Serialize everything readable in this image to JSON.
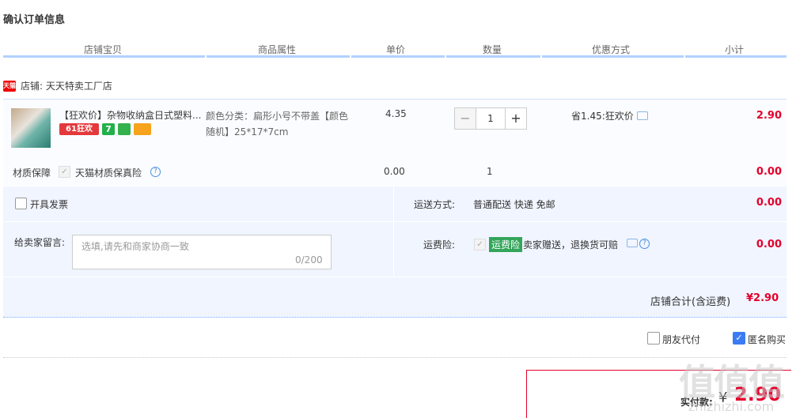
{
  "page_title": "确认订单信息",
  "columns": [
    "店铺宝贝",
    "商品属性",
    "单价",
    "数量",
    "优惠方式",
    "小计"
  ],
  "shop": {
    "badge": "天猫",
    "name": "店铺: 天天特卖工厂店"
  },
  "item": {
    "title": "【狂欢价】杂物收纳盒日式塑料...",
    "tag_61": "61狂欢",
    "tag_7": "7",
    "attr_line1": "颜色分类：扁形小号不带盖【颜色",
    "attr_line2": "随机】25*17*7cm",
    "price": "4.35",
    "qty_minus": "−",
    "qty_value": "1",
    "qty_plus": "+",
    "discount": "省1.45:狂欢价",
    "subtotal": "2.90"
  },
  "material": {
    "label": "材质保障",
    "check": "✓",
    "text": "天猫材质保真险",
    "help": "?",
    "price": "0.00",
    "qty": "1",
    "subtotal": "0.00"
  },
  "invoice": {
    "label": "开具发票"
  },
  "shipping": {
    "label": "运送方式:",
    "value": "普通配送 快递 免邮",
    "subtotal": "0.00"
  },
  "message": {
    "label": "给卖家留言:",
    "placeholder": "选填,请先和商家协商一致",
    "count": "0/200"
  },
  "insurance": {
    "label": "运费险:",
    "check": "✓",
    "badge": "运费险",
    "text": "卖家赠送，退换货可赔",
    "help": "?",
    "subtotal": "0.00"
  },
  "shop_total": {
    "label": "店铺合计(含运费)",
    "value": "¥2.90"
  },
  "options": {
    "friend_pay": "朋友代付",
    "anonymous": "匿名购买",
    "anon_check": "✓"
  },
  "payment": {
    "label": "实付款:",
    "currency": "¥",
    "value": "2.90"
  },
  "watermark": {
    "text": "值值值",
    "site": "zhizhizhi.com"
  },
  "colors": {
    "accent_red": "#e4002b",
    "header_line": "#b2d1ff",
    "blue_bg": "#f0f5ff",
    "check_blue": "#3b7bf3"
  }
}
